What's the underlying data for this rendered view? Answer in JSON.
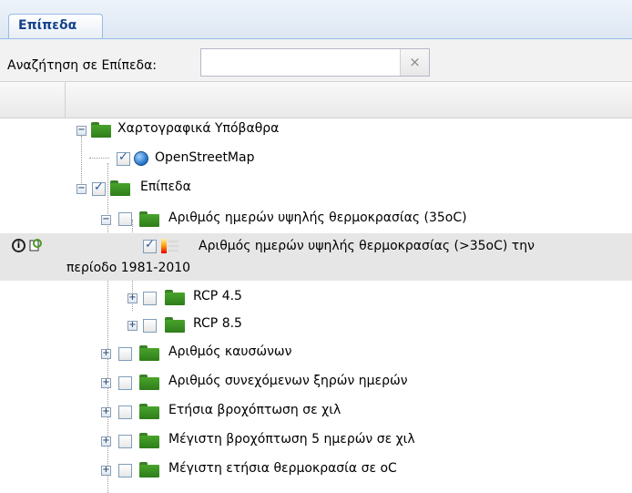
{
  "tab": {
    "label": "Επίπεδα"
  },
  "search": {
    "label": "Αναζήτηση σε Επίπεδα:",
    "value": "",
    "placeholder": "",
    "clear_symbol": "×"
  },
  "tree": {
    "basemaps": {
      "label": "Χαρτογραφικά Υπόβαθρα",
      "expander": "−"
    },
    "osm": {
      "label": "OpenStreetMap",
      "checked": true
    },
    "layers": {
      "label": "Επίπεδα",
      "expander": "−",
      "checked": true
    },
    "hotdays": {
      "label": "Αριθμός ημερών υψηλής θερμοκρασίας (35oC)",
      "expander": "−",
      "checked": false
    },
    "hotdays_layer": {
      "label_line1": "Αριθμός ημερών υψηλής θερμοκρασίας (>35oC) την",
      "label_line2": "περίοδο 1981-2010",
      "checked": true
    },
    "rcp45": {
      "label": "RCP 4.5",
      "expander": "+",
      "checked": false
    },
    "rcp85": {
      "label": "RCP 8.5",
      "expander": "+",
      "checked": false
    },
    "heatwaves": {
      "label": "Αριθμός καυσώνων",
      "expander": "+",
      "checked": false
    },
    "drydays": {
      "label": "Αριθμός συνεχόμενων ξηρών ημερών",
      "expander": "+",
      "checked": false
    },
    "annual_precip": {
      "label": "Ετήσια βροχόπτωση σε χιλ",
      "expander": "+",
      "checked": false
    },
    "max5day_precip": {
      "label": "Μέγιστη βροχόπτωση 5 ημερών σε χιλ",
      "expander": "+",
      "checked": false
    },
    "max_temp": {
      "label": "Μέγιστη ετήσια θερμοκρασία σε oC",
      "expander": "+",
      "checked": false
    }
  },
  "icons": {
    "info": "info-icon",
    "refresh": "refresh-icon"
  },
  "colors": {
    "tab_text": "#15428b",
    "folder": "#3d9422",
    "selected_row": "#e6e6e6"
  }
}
